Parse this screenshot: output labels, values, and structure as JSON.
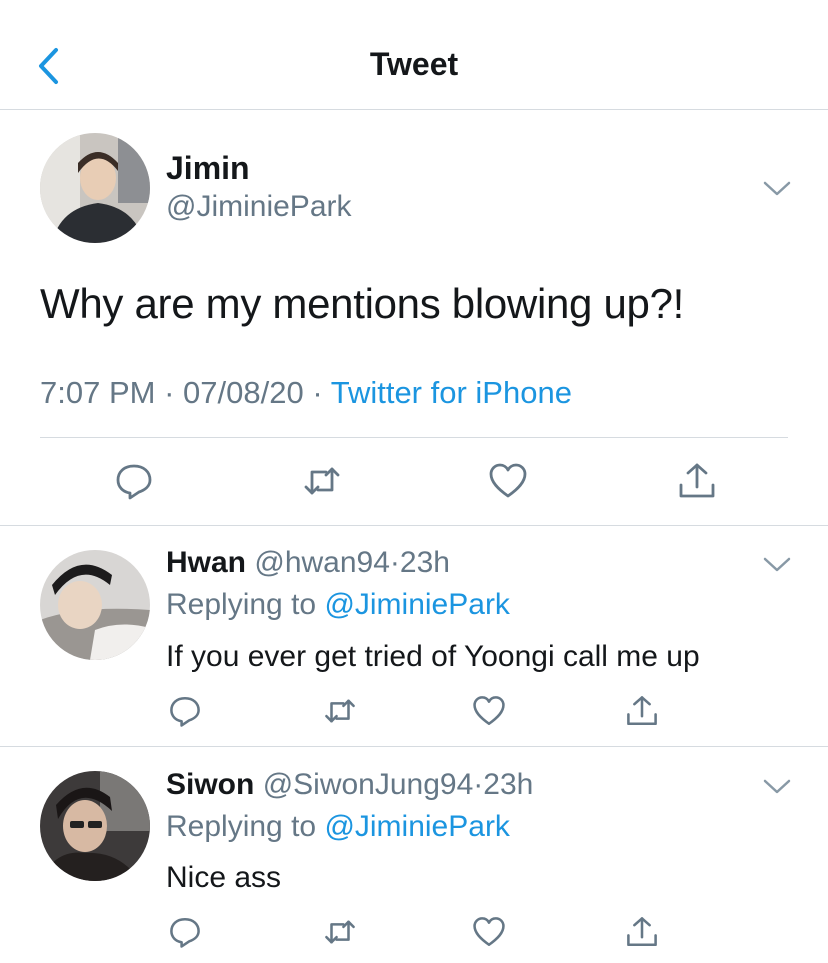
{
  "header": {
    "title": "Tweet",
    "back_icon": "chevron-left-icon"
  },
  "colors": {
    "accent": "#1b95e0",
    "text": "#14171a",
    "muted": "#657786",
    "divider": "#d6dbe0"
  },
  "tweet": {
    "name": "Jimin",
    "handle": "@JiminiePark",
    "text": "Why are my mentions blowing up?!",
    "time": "7:07 PM",
    "date": "07/08/20",
    "separator": "·",
    "source": "Twitter for iPhone",
    "actions": [
      "reply-icon",
      "retweet-icon",
      "like-icon",
      "share-icon"
    ]
  },
  "replies": [
    {
      "name": "Hwan",
      "handle": "@hwan94",
      "time": "23h",
      "separator": "·",
      "replying_prefix": "Replying to",
      "replying_to": "@JiminiePark",
      "text": "If you ever get tried of Yoongi call me up"
    },
    {
      "name": "Siwon",
      "handle": "@SiwonJung94",
      "time": "23h",
      "separator": "·",
      "replying_prefix": "Replying to",
      "replying_to": "@JiminiePark",
      "text": "Nice ass"
    }
  ]
}
